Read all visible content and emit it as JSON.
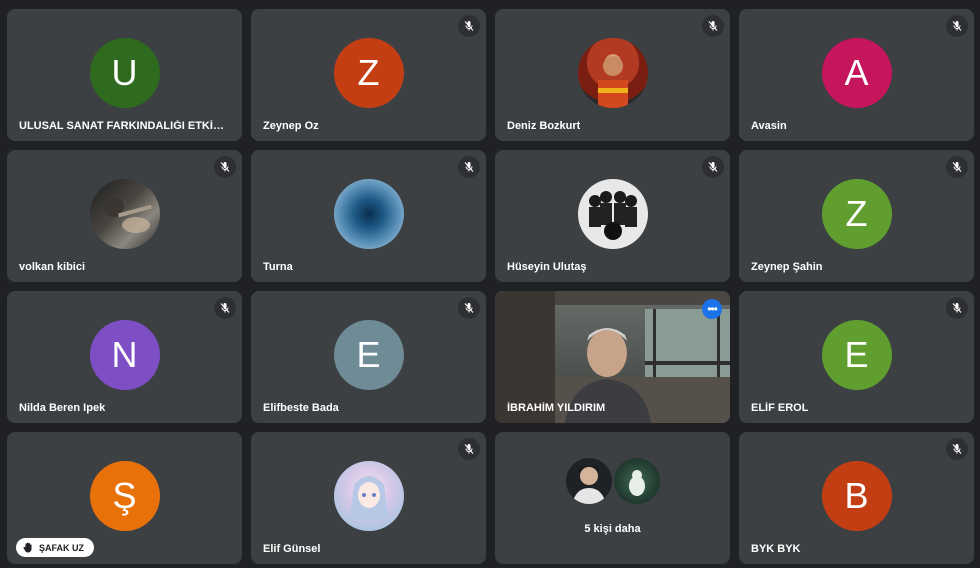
{
  "tiles": [
    {
      "name": "ULUSAL SANAT FARKINDALIĞI ETKİNLİ...",
      "initial": "U",
      "avatar_color": "#2e6b1e",
      "muted": false
    },
    {
      "name": "Zeynep Oz",
      "initial": "Z",
      "avatar_color": "#c43e14",
      "muted": true
    },
    {
      "name": "Deniz Bozkurt",
      "photo": "football-player-photo",
      "muted": true
    },
    {
      "name": "Avasin",
      "initial": "A",
      "avatar_color": "#c4155d",
      "muted": true
    },
    {
      "name": "volkan kibici",
      "photo": "violinist-photo",
      "muted": true
    },
    {
      "name": "Turna",
      "photo": "blue-gradient-photo",
      "muted": true
    },
    {
      "name": "Hüseyin Ulutaş",
      "photo": "beatles-photo",
      "muted": true
    },
    {
      "name": "Zeynep Şahin",
      "initial": "Z",
      "avatar_color": "#5f9e2f",
      "muted": true
    },
    {
      "name": "Nilda Beren Ipek",
      "initial": "N",
      "avatar_color": "#7e4fc4",
      "muted": true
    },
    {
      "name": "Elifbeste Bada",
      "initial": "E",
      "avatar_color": "#6f8b95",
      "muted": true
    },
    {
      "name": "İBRAHİM YILDIRIM",
      "video": true,
      "active": true
    },
    {
      "name": "ELİF EROL",
      "initial": "E",
      "avatar_color": "#5f9e2f",
      "muted": true
    },
    {
      "name": "",
      "initial": "Ş",
      "avatar_color": "#e8710a",
      "muted": false
    },
    {
      "name": "Elif Günsel",
      "photo": "anime-girl-photo",
      "muted": true
    },
    {
      "name": "",
      "others": true,
      "more_text": "5 kişi daha"
    },
    {
      "name": "BYK BYK",
      "initial": "B",
      "avatar_color": "#c43e14",
      "muted": true
    }
  ],
  "presenter": {
    "label": "ŞAFAK UZ"
  },
  "colors": {
    "background": "#202124",
    "tile": "#3c4043",
    "active_border": "#8ab4f8",
    "menu_button": "#1a73e8"
  }
}
